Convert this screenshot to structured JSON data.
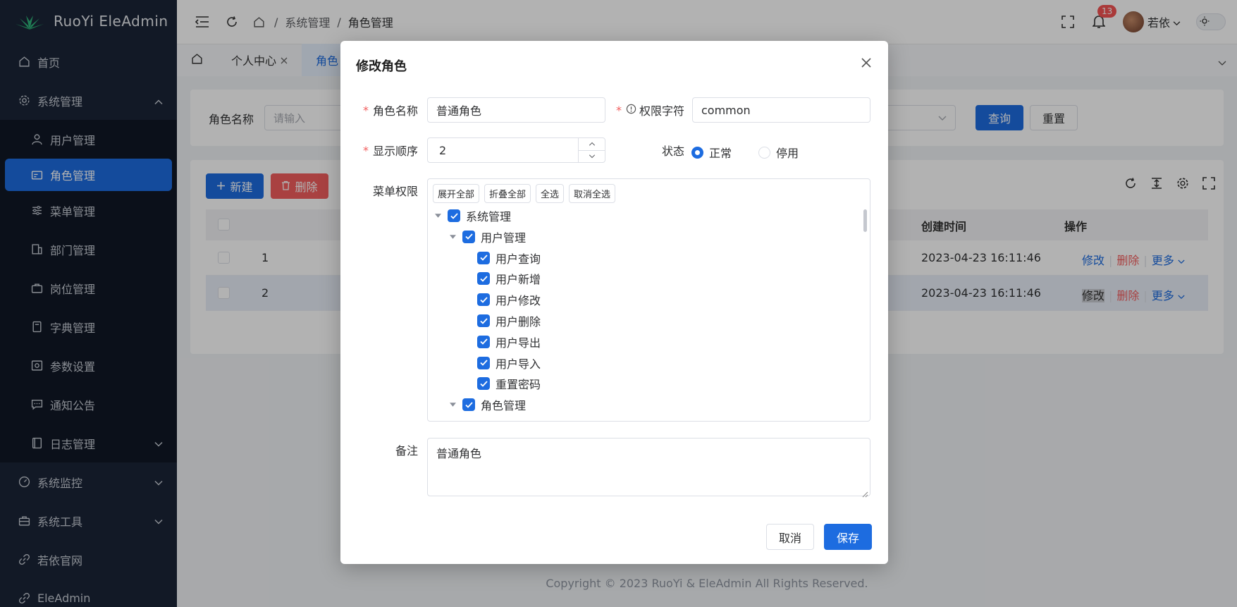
{
  "app": {
    "title": "RuoYi EleAdmin"
  },
  "sidebar": {
    "items": [
      {
        "label": "首页",
        "icon": "home-icon"
      },
      {
        "label": "系统管理",
        "icon": "gear-icon"
      },
      {
        "label": "用户管理",
        "icon": "user-icon"
      },
      {
        "label": "角色管理",
        "icon": "id-card-icon"
      },
      {
        "label": "菜单管理",
        "icon": "sliders-icon"
      },
      {
        "label": "部门管理",
        "icon": "building-icon"
      },
      {
        "label": "岗位管理",
        "icon": "briefcase-icon"
      },
      {
        "label": "字典管理",
        "icon": "book-icon"
      },
      {
        "label": "参数设置",
        "icon": "settings-panel-icon"
      },
      {
        "label": "通知公告",
        "icon": "message-icon"
      },
      {
        "label": "日志管理",
        "icon": "log-icon"
      },
      {
        "label": "系统监控",
        "icon": "gauge-icon"
      },
      {
        "label": "系统工具",
        "icon": "toolbox-icon"
      },
      {
        "label": "若依官网",
        "icon": "link-icon"
      },
      {
        "label": "EleAdmin",
        "icon": "link-icon"
      }
    ]
  },
  "topbar": {
    "breadcrumb": [
      "系统管理",
      "角色管理"
    ],
    "notification_count": "13",
    "username": "若依"
  },
  "tabs": [
    {
      "label": "个人中心"
    },
    {
      "label": "角色"
    }
  ],
  "search": {
    "label": "角色名称",
    "placeholder": "请输入",
    "query_btn": "查询",
    "reset_btn": "重置"
  },
  "toolbar": {
    "new_btn": "新建",
    "delete_btn": "删除"
  },
  "table": {
    "headers": {
      "created": "创建时间",
      "actions": "操作"
    },
    "rows": [
      {
        "id": "1",
        "created": "2023-04-23 16:11:46"
      },
      {
        "id": "2",
        "created": "2023-04-23 16:11:46"
      }
    ],
    "actions": {
      "edit": "修改",
      "delete": "删除",
      "more": "更多"
    }
  },
  "footer": {
    "copyright": "Copyright © 2023 RuoYi & EleAdmin All Rights Reserved."
  },
  "modal": {
    "title": "修改角色",
    "fields": {
      "role_name_label": "角色名称",
      "role_name_value": "普通角色",
      "perm_key_label": "权限字符",
      "perm_key_value": "common",
      "order_label": "显示顺序",
      "order_value": "2",
      "status_label": "状态",
      "status_normal": "正常",
      "status_disabled": "停用",
      "menu_label": "菜单权限",
      "remark_label": "备注",
      "remark_value": "普通角色"
    },
    "tree_buttons": [
      "展开全部",
      "折叠全部",
      "全选",
      "取消全选"
    ],
    "tree": [
      {
        "label": "系统管理",
        "level": 0,
        "caret": true
      },
      {
        "label": "用户管理",
        "level": 1,
        "caret": true
      },
      {
        "label": "用户查询",
        "level": 2
      },
      {
        "label": "用户新增",
        "level": 2
      },
      {
        "label": "用户修改",
        "level": 2
      },
      {
        "label": "用户删除",
        "level": 2
      },
      {
        "label": "用户导出",
        "level": 2
      },
      {
        "label": "用户导入",
        "level": 2
      },
      {
        "label": "重置密码",
        "level": 2
      },
      {
        "label": "角色管理",
        "level": 1,
        "caret": true
      }
    ],
    "cancel_btn": "取消",
    "save_btn": "保存"
  },
  "colors": {
    "primary": "#1d6ce0",
    "danger": "#f25e5e",
    "sidebar_bg": "#1b2537"
  }
}
